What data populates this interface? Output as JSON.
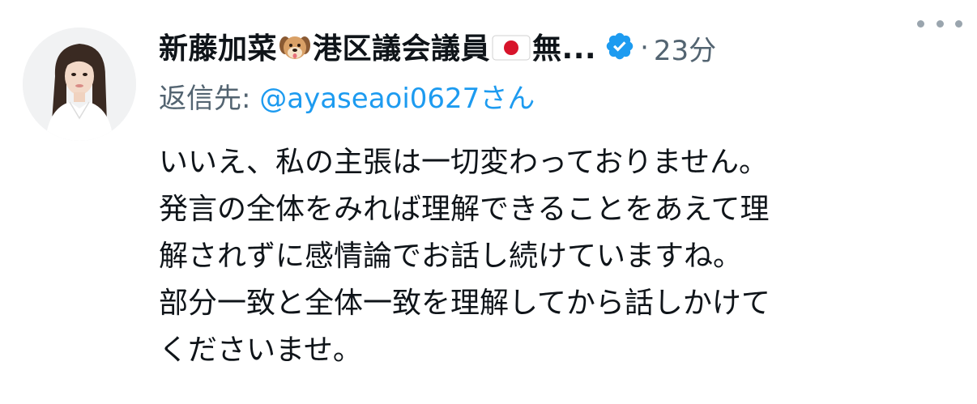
{
  "author": {
    "name_part1": "新藤加菜",
    "name_part2": "港区議会議員",
    "name_part3": "無...",
    "emoji1": "dog-face-emoji",
    "emoji2": "japan-flag-emoji",
    "verified_icon": "verified-badge-icon",
    "verified_color": "#1d9bf0"
  },
  "meta": {
    "separator": "·",
    "time": "23分"
  },
  "reply": {
    "prefix": "返信先: ",
    "handle": "@ayaseaoi0627",
    "suffix": "さん"
  },
  "tweet": {
    "lines": [
      "いいえ、私の主張は一切変わっておりません。",
      "発言の全体をみれば理解できることをあえて理",
      "解されずに感情論でお話し続けていますね。",
      "部分一致と全体一致を理解してから話しかけて",
      "くださいませ。"
    ]
  }
}
